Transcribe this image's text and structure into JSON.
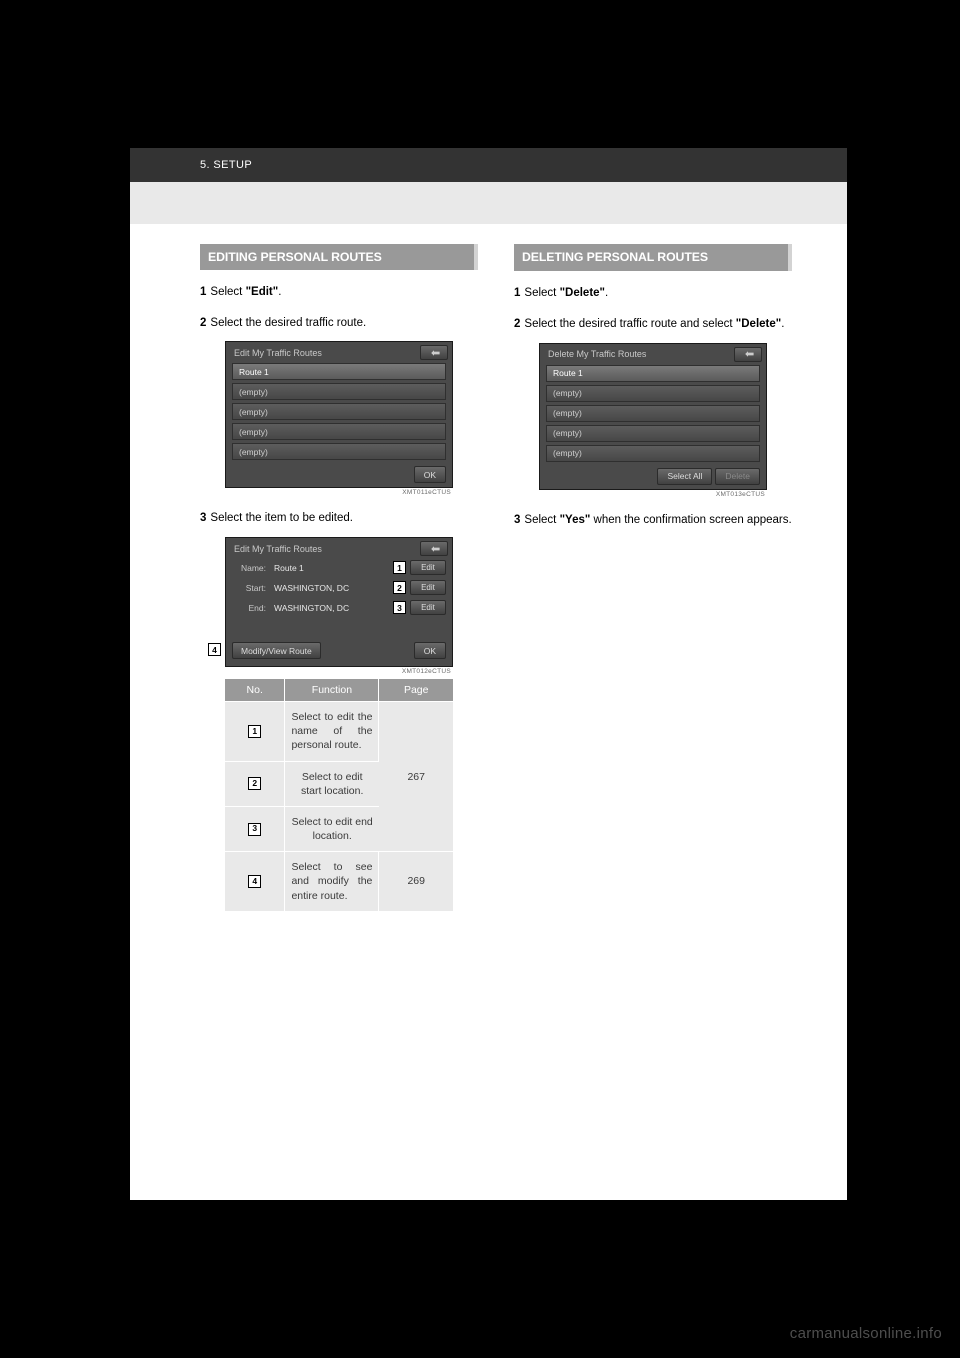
{
  "header": {
    "chapter": "5. SETUP"
  },
  "left": {
    "section_title": "EDITING PERSONAL ROUTES",
    "step1_num": "1",
    "step1_a": "Select ",
    "step1_b": "\"Edit\"",
    "step1_c": ".",
    "step2_num": "2",
    "step2": "Select the desired traffic route.",
    "step3_num": "3",
    "step3": "Select the item to be edited.",
    "mock1": {
      "title": "Edit My Traffic Routes",
      "row1": "Route 1",
      "empty": "(empty)",
      "ok": "OK",
      "code": "XMT011eCTUS"
    },
    "mock2": {
      "title": "Edit My Traffic Routes",
      "name_label": "Name:",
      "name_val": "Route 1",
      "start_label": "Start:",
      "start_val": "WASHINGTON, DC",
      "end_label": "End:",
      "end_val": "WASHINGTON, DC",
      "edit_btn": "Edit",
      "modify": "Modify/View Route",
      "ok": "OK",
      "code": "XMT012eCTUS",
      "n1": "1",
      "n2": "2",
      "n3": "3",
      "n4": "4"
    },
    "table": {
      "h1": "No.",
      "h2": "Function",
      "h3": "Page",
      "r1_n": "1",
      "r1_f": "Select to edit the name of the personal route.",
      "r2_n": "2",
      "r2_f": "Select to edit start location.",
      "r3_n": "3",
      "r3_f": "Select to edit end location.",
      "page_267": "267",
      "r4_n": "4",
      "r4_f": "Select to see and modify the entire route.",
      "r4_p": "269"
    }
  },
  "right": {
    "section_title": "DELETING PERSONAL ROUTES",
    "step1_num": "1",
    "step1_a": "Select ",
    "step1_b": "\"Delete\"",
    "step1_c": ".",
    "step2_num": "2",
    "step2_a": "Select the desired traffic route and select ",
    "step2_b": "\"Delete\"",
    "step2_c": ".",
    "step3_num": "3",
    "step3_a": "Select ",
    "step3_b": "\"Yes\"",
    "step3_c": " when the confirmation screen appears.",
    "mock": {
      "title": "Delete My Traffic Routes",
      "row1": "Route 1",
      "empty": "(empty)",
      "select_all": "Select All",
      "delete": "Delete",
      "code": "XMT013eCTUS"
    }
  },
  "watermark": "carmanualsonline.info"
}
